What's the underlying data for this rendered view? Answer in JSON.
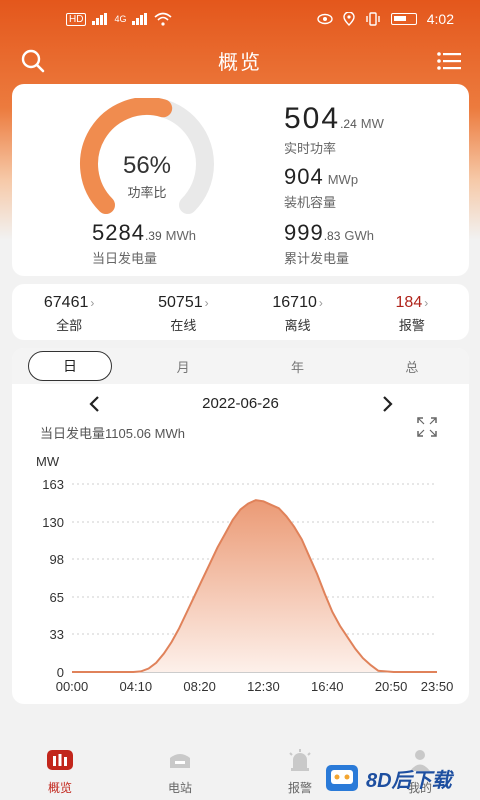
{
  "status_bar": {
    "time": "4:02",
    "hd": "HD",
    "net": "4G"
  },
  "header": {
    "title": "概览"
  },
  "summary": {
    "power_ratio": {
      "percent": 56,
      "percent_label": "56%",
      "label": "功率比"
    },
    "realtime_power": {
      "int": "504",
      "dec": ".24",
      "unit": "MW",
      "label": "实时功率"
    },
    "installed_capacity": {
      "int": "904",
      "dec": "",
      "unit": "MWp",
      "label": "装机容量"
    },
    "daily_generation": {
      "int": "5284",
      "dec": ".39",
      "unit": "MWh",
      "label": "当日发电量"
    },
    "total_generation": {
      "int": "999",
      "dec": ".83",
      "unit": "GWh",
      "label": "累计发电量"
    }
  },
  "counts": [
    {
      "value": "67461",
      "label": "全部",
      "chevron": "›"
    },
    {
      "value": "50751",
      "label": "在线",
      "chevron": "›"
    },
    {
      "value": "16710",
      "label": "离线",
      "chevron": "›"
    },
    {
      "value": "184",
      "label": "报警",
      "chevron": "›"
    }
  ],
  "chart_tabs": [
    "日",
    "月",
    "年",
    "总"
  ],
  "chart_header": {
    "date": "2022-06-26",
    "daily_generation": "当日发电量1105.06 MWh"
  },
  "chart_data": {
    "type": "area",
    "ylabel": "MW",
    "y_ticks": [
      0,
      33,
      65,
      98,
      130,
      163
    ],
    "ylim": [
      0,
      163
    ],
    "x_ticks": [
      "00:00",
      "04:10",
      "08:20",
      "12:30",
      "16:40",
      "20:50",
      "23:50"
    ],
    "x_hours": [
      0,
      1,
      2,
      3,
      4,
      4.5,
      5,
      5.5,
      6,
      6.5,
      7,
      7.5,
      8,
      8.5,
      9,
      9.5,
      10,
      10.5,
      11,
      11.5,
      12,
      12.5,
      13,
      13.5,
      14,
      14.5,
      15,
      15.5,
      16,
      16.5,
      17,
      17.5,
      18,
      18.5,
      19,
      19.5,
      20,
      21,
      22,
      23,
      23.83
    ],
    "values": [
      0,
      0,
      0,
      0,
      0,
      0.5,
      3,
      8,
      16,
      26,
      38,
      52,
      66,
      80,
      94,
      108,
      120,
      132,
      141,
      146,
      149,
      148,
      145,
      142,
      135,
      126,
      115,
      100,
      85,
      68,
      52,
      40,
      30,
      20,
      12,
      6,
      1,
      0,
      0,
      0,
      0
    ],
    "grid": true,
    "line_color": "#e0825a",
    "fill_top": "#eb9a75",
    "fill_bottom": "#fdf0ea"
  },
  "tabbar": [
    {
      "label": "概览",
      "icon": "overview-bars-icon",
      "active": true
    },
    {
      "label": "电站",
      "icon": "station-icon",
      "active": false
    },
    {
      "label": "报警",
      "icon": "alarm-icon",
      "active": false
    },
    {
      "label": "我的",
      "icon": "user-icon",
      "active": false
    }
  ],
  "watermark": {
    "text": "8D后下载"
  },
  "colors": {
    "brand": "#e4571c",
    "alarm": "#b0241b",
    "gauge_fill": "#f08c4f",
    "gauge_track": "#e9e9e9"
  }
}
